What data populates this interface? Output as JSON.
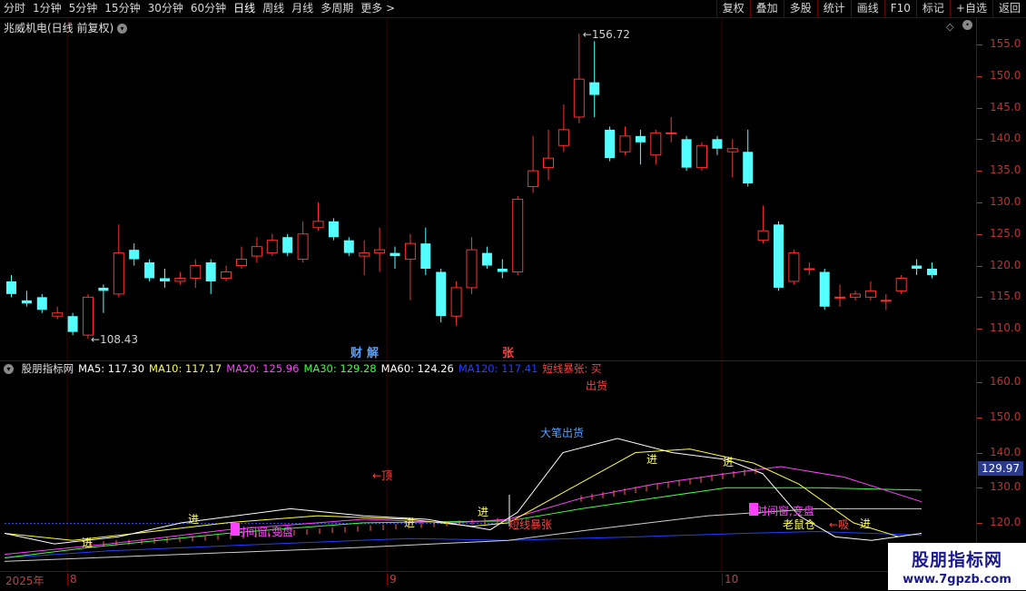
{
  "toolbar": {
    "periods": [
      "分时",
      "1分钟",
      "5分钟",
      "15分钟",
      "30分钟",
      "60分钟",
      "日线",
      "周线",
      "月线",
      "多周期",
      "更多 >"
    ],
    "active_period": "日线",
    "right_buttons": [
      "复权",
      "叠加",
      "多股",
      "统计",
      "画线",
      "F10",
      "标记",
      "+自选",
      "返回"
    ]
  },
  "chart": {
    "title": "兆威机电(日线 前复权)",
    "high_label": "156.72",
    "low_label": "108.43",
    "price_ticks": [
      "155.0",
      "150.0",
      "145.0",
      "140.0",
      "135.0",
      "130.0",
      "125.0",
      "120.0",
      "115.0",
      "110.0"
    ],
    "events": [
      {
        "text": "财",
        "color": "#56a0ff"
      },
      {
        "text": "解",
        "color": "#56a0ff"
      },
      {
        "text": "张",
        "color": "#ff4040"
      }
    ]
  },
  "indicator": {
    "name": "股朋指标网",
    "legend": [
      {
        "label": "MA5: 117.30",
        "color": "#ffffff"
      },
      {
        "label": "MA10: 117.17",
        "color": "#ffff40"
      },
      {
        "label": "MA20: 125.96",
        "color": "#ff40ff"
      },
      {
        "label": "MA30: 129.28",
        "color": "#40ff40"
      },
      {
        "label": "MA60: 124.26",
        "color": "#ffffff"
      },
      {
        "label": "MA120: 117.41",
        "color": "#2040ff"
      },
      {
        "label": "短线暴张: 买",
        "color": "#ff4040"
      }
    ],
    "ticks": [
      "160.0",
      "150.0",
      "140.0",
      "130.0",
      "120.0"
    ],
    "current_value": "129.97",
    "annotations": {
      "top_sell": "出货",
      "big_sell": "大笔出货",
      "top_arrow": "←顶",
      "enter1": "进",
      "enter2": "进",
      "enter3": "进",
      "enter4": "进",
      "enter5": "进",
      "enter6": "进",
      "time_window1": "时间窗,变盘",
      "time_window2": "时间窗,变盘",
      "short_surge": "短线暴张",
      "mouse_pos": "老鼠仓",
      "absorb": "←吸"
    }
  },
  "dates": {
    "year": "2025年",
    "months": [
      "8",
      "9",
      "10"
    ]
  },
  "watermark": {
    "line1": "股朋指标网",
    "line2": "www.7gpzb.com"
  },
  "chart_data": {
    "type": "candlestick",
    "ylim": [
      106,
      158
    ],
    "candles": [
      {
        "o": 117.5,
        "c": 115.5,
        "h": 118.5,
        "l": 115
      },
      {
        "o": 114.5,
        "c": 114.0,
        "h": 116,
        "l": 113.5
      },
      {
        "o": 115.0,
        "c": 113.0,
        "h": 115.5,
        "l": 112.5
      },
      {
        "o": 112.0,
        "c": 112.5,
        "h": 113.5,
        "l": 111.5
      },
      {
        "o": 112.0,
        "c": 109.5,
        "h": 112.5,
        "l": 109
      },
      {
        "o": 109.0,
        "c": 115.0,
        "h": 115.5,
        "l": 108.43
      },
      {
        "o": 116.5,
        "c": 116.0,
        "h": 117,
        "l": 112.5
      },
      {
        "o": 115.5,
        "c": 122.0,
        "h": 126.5,
        "l": 115
      },
      {
        "o": 122.5,
        "c": 121.0,
        "h": 123.5,
        "l": 120
      },
      {
        "o": 120.5,
        "c": 118.0,
        "h": 121,
        "l": 117.5
      },
      {
        "o": 118.0,
        "c": 117.5,
        "h": 119.5,
        "l": 116.5
      },
      {
        "o": 117.5,
        "c": 118.0,
        "h": 119,
        "l": 117
      },
      {
        "o": 118.0,
        "c": 120.0,
        "h": 121,
        "l": 116.5
      },
      {
        "o": 120.5,
        "c": 117.5,
        "h": 121,
        "l": 115.5
      },
      {
        "o": 118.0,
        "c": 119.0,
        "h": 120,
        "l": 117.5
      },
      {
        "o": 120.0,
        "c": 121.0,
        "h": 123,
        "l": 119.5
      },
      {
        "o": 121.5,
        "c": 123.0,
        "h": 124.5,
        "l": 120.5
      },
      {
        "o": 122.0,
        "c": 124.0,
        "h": 125,
        "l": 121.5
      },
      {
        "o": 124.5,
        "c": 122.0,
        "h": 125,
        "l": 121.5
      },
      {
        "o": 121.0,
        "c": 125.0,
        "h": 127,
        "l": 120.5
      },
      {
        "o": 126.0,
        "c": 127.0,
        "h": 130,
        "l": 125.5
      },
      {
        "o": 127.0,
        "c": 124.5,
        "h": 127.5,
        "l": 124
      },
      {
        "o": 124.0,
        "c": 122.0,
        "h": 124.5,
        "l": 121.5
      },
      {
        "o": 121.5,
        "c": 122.0,
        "h": 124,
        "l": 118.5
      },
      {
        "o": 122.0,
        "c": 122.5,
        "h": 126,
        "l": 119
      },
      {
        "o": 122.0,
        "c": 121.5,
        "h": 123,
        "l": 119.5
      },
      {
        "o": 121.0,
        "c": 123.5,
        "h": 125,
        "l": 114.5
      },
      {
        "o": 123.5,
        "c": 119.5,
        "h": 126,
        "l": 118.5
      },
      {
        "o": 119.0,
        "c": 112.0,
        "h": 119.5,
        "l": 111
      },
      {
        "o": 112.0,
        "c": 116.5,
        "h": 117.5,
        "l": 110.5
      },
      {
        "o": 116.5,
        "c": 122.5,
        "h": 124.5,
        "l": 115.5
      },
      {
        "o": 122.0,
        "c": 120.0,
        "h": 123,
        "l": 119.5
      },
      {
        "o": 119.5,
        "c": 119.0,
        "h": 121,
        "l": 118
      },
      {
        "o": 119.0,
        "c": 130.5,
        "h": 131,
        "l": 118.5
      },
      {
        "o": 132.5,
        "c": 135.0,
        "h": 140.5,
        "l": 131.5
      },
      {
        "o": 135.5,
        "c": 137.0,
        "h": 141.5,
        "l": 133.5
      },
      {
        "o": 139.0,
        "c": 141.5,
        "h": 145.5,
        "l": 138
      },
      {
        "o": 143.5,
        "c": 149.5,
        "h": 156.72,
        "l": 142.5
      },
      {
        "o": 149.0,
        "c": 147.0,
        "h": 155.5,
        "l": 143.5
      },
      {
        "o": 141.5,
        "c": 137.0,
        "h": 142,
        "l": 136.5
      },
      {
        "o": 138.0,
        "c": 140.5,
        "h": 142,
        "l": 137.5
      },
      {
        "o": 140.5,
        "c": 139.5,
        "h": 141.5,
        "l": 136
      },
      {
        "o": 137.5,
        "c": 141.0,
        "h": 141.5,
        "l": 136
      },
      {
        "o": 141.0,
        "c": 141.0,
        "h": 143.5,
        "l": 139.5
      },
      {
        "o": 140.0,
        "c": 135.5,
        "h": 140.5,
        "l": 135
      },
      {
        "o": 135.5,
        "c": 139.0,
        "h": 139.5,
        "l": 135
      },
      {
        "o": 140.0,
        "c": 138.5,
        "h": 140.5,
        "l": 137.5
      },
      {
        "o": 138.0,
        "c": 138.5,
        "h": 140,
        "l": 134
      },
      {
        "o": 138.0,
        "c": 133.0,
        "h": 141.5,
        "l": 132.5
      },
      {
        "o": 124.0,
        "c": 125.5,
        "h": 129.5,
        "l": 123.5
      },
      {
        "o": 126.5,
        "c": 116.5,
        "h": 127,
        "l": 116
      },
      {
        "o": 117.5,
        "c": 122.0,
        "h": 122.5,
        "l": 117
      },
      {
        "o": 119.5,
        "c": 119.5,
        "h": 120.5,
        "l": 118.5
      },
      {
        "o": 119.0,
        "c": 113.5,
        "h": 119.5,
        "l": 113
      },
      {
        "o": 115.0,
        "c": 115.0,
        "h": 117,
        "l": 113.5
      },
      {
        "o": 115.0,
        "c": 115.5,
        "h": 116,
        "l": 114.5
      },
      {
        "o": 115.0,
        "c": 116.0,
        "h": 117.5,
        "l": 114.5
      },
      {
        "o": 114.5,
        "c": 114.5,
        "h": 115.5,
        "l": 113
      },
      {
        "o": 116.0,
        "c": 118.0,
        "h": 118.5,
        "l": 115.5
      },
      {
        "o": 120.0,
        "c": 119.5,
        "h": 121,
        "l": 118.5
      },
      {
        "o": 119.5,
        "c": 118.5,
        "h": 120.5,
        "l": 118
      }
    ]
  }
}
